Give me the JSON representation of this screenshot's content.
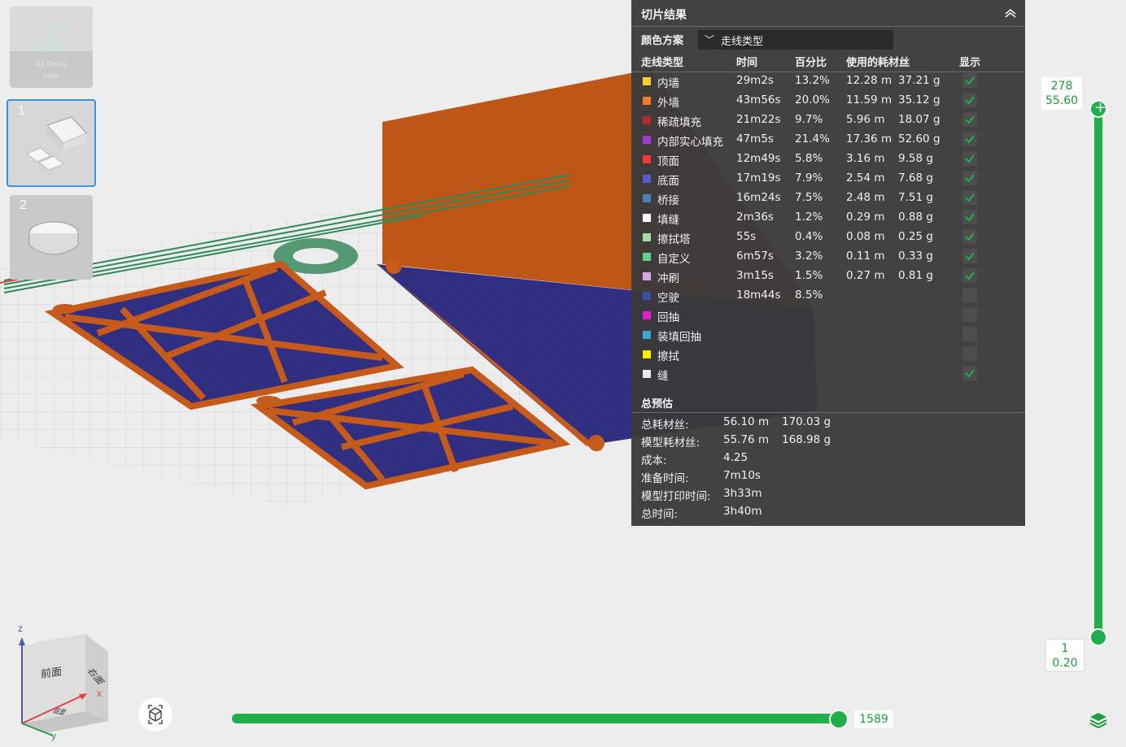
{
  "plates": {
    "all_label_line1": "All Plates",
    "all_label_line2": "Stats",
    "plate1_number": "1",
    "plate2_number": "2"
  },
  "panel": {
    "title": "切片结果",
    "color_scheme_label": "颜色方案",
    "color_scheme_value": "走线类型",
    "headers": {
      "type": "走线类型",
      "time": "时间",
      "percent": "百分比",
      "used": "使用的耗材丝",
      "show": "显示"
    },
    "rows": [
      {
        "name": "内墙",
        "color": "#f2d02d",
        "time": "29m2s",
        "pct": "13.2%",
        "len": "12.28 m",
        "weight": "37.21 g",
        "checked": true
      },
      {
        "name": "外墙",
        "color": "#f07a25",
        "time": "43m56s",
        "pct": "20.0%",
        "len": "11.59 m",
        "weight": "35.12 g",
        "checked": true
      },
      {
        "name": "稀疏填充",
        "color": "#b52a2a",
        "time": "21m22s",
        "pct": "9.7%",
        "len": "5.96 m",
        "weight": "18.07 g",
        "checked": true
      },
      {
        "name": "内部实心填充",
        "color": "#9a3dd1",
        "time": "47m5s",
        "pct": "21.4%",
        "len": "17.36 m",
        "weight": "52.60 g",
        "checked": true
      },
      {
        "name": "顶面",
        "color": "#f03a3a",
        "time": "12m49s",
        "pct": "5.8%",
        "len": "3.16 m",
        "weight": "9.58 g",
        "checked": true
      },
      {
        "name": "底面",
        "color": "#5a5ad0",
        "time": "17m19s",
        "pct": "7.9%",
        "len": "2.54 m",
        "weight": "7.68 g",
        "checked": true
      },
      {
        "name": "桥接",
        "color": "#4a7fb8",
        "time": "16m24s",
        "pct": "7.5%",
        "len": "2.48 m",
        "weight": "7.51 g",
        "checked": true
      },
      {
        "name": "填缝",
        "color": "#ffffff",
        "time": "2m36s",
        "pct": "1.2%",
        "len": "0.29 m",
        "weight": "0.88 g",
        "checked": true
      },
      {
        "name": "擦拭塔",
        "color": "#a9dba4",
        "time": "55s",
        "pct": "0.4%",
        "len": "0.08 m",
        "weight": "0.25 g",
        "checked": true
      },
      {
        "name": "自定义",
        "color": "#5fcf8a",
        "time": "6m57s",
        "pct": "3.2%",
        "len": "0.11 m",
        "weight": "0.33 g",
        "checked": true
      },
      {
        "name": "冲刷",
        "color": "#d7a4e8",
        "time": "3m15s",
        "pct": "1.5%",
        "len": "0.27 m",
        "weight": "0.81 g",
        "checked": true
      },
      {
        "name": "空驶",
        "color": "#3b4fa8",
        "time": "18m44s",
        "pct": "8.5%",
        "len": "",
        "weight": "",
        "checked": false
      },
      {
        "name": "回抽",
        "color": "#e020c8",
        "time": "",
        "pct": "",
        "len": "",
        "weight": "",
        "checked": false
      },
      {
        "name": "装填回抽",
        "color": "#3ca8d0",
        "time": "",
        "pct": "",
        "len": "",
        "weight": "",
        "checked": false
      },
      {
        "name": "擦拭",
        "color": "#f5f000",
        "time": "",
        "pct": "",
        "len": "",
        "weight": "",
        "checked": false
      },
      {
        "name": "缝",
        "color": "#e8e8e8",
        "time": "",
        "pct": "",
        "len": "",
        "weight": "",
        "checked": true
      }
    ],
    "summary_title": "总预估",
    "summary": [
      {
        "label": "总耗材丝:",
        "v1": "56.10 m",
        "v2": "170.03 g"
      },
      {
        "label": "模型耗材丝:",
        "v1": "55.76 m",
        "v2": "168.98 g"
      },
      {
        "label": "成本:",
        "v1": "4.25",
        "v2": ""
      },
      {
        "label": "准备时间:",
        "v1": "7m10s",
        "v2": ""
      },
      {
        "label": "模型打印时间:",
        "v1": "3h33m",
        "v2": ""
      },
      {
        "label": "总时间:",
        "v1": "3h40m",
        "v2": ""
      }
    ]
  },
  "vslider": {
    "top_layer": "278",
    "top_height": "55.60",
    "bottom_layer": "1",
    "bottom_height": "0.20",
    "top_fraction": 1.0,
    "bottom_fraction": 0.0
  },
  "hslider": {
    "value": "1589",
    "fraction": 1.0
  },
  "view_cube": {
    "front": "前面",
    "right": "右面",
    "bottom": "底面",
    "axis_x": "x",
    "axis_y": "y",
    "axis_z": "z"
  },
  "icons": {
    "reset": "reset-view-icon",
    "layers": "layers-icon",
    "collapse": "collapse-icon",
    "check": "check-icon"
  },
  "colors": {
    "accent": "#1fae4a",
    "selection": "#3d8fe0",
    "panel_bg": "#3a3a3a",
    "model_orange": "#c55a1a",
    "model_blue": "#2b2a7a"
  }
}
